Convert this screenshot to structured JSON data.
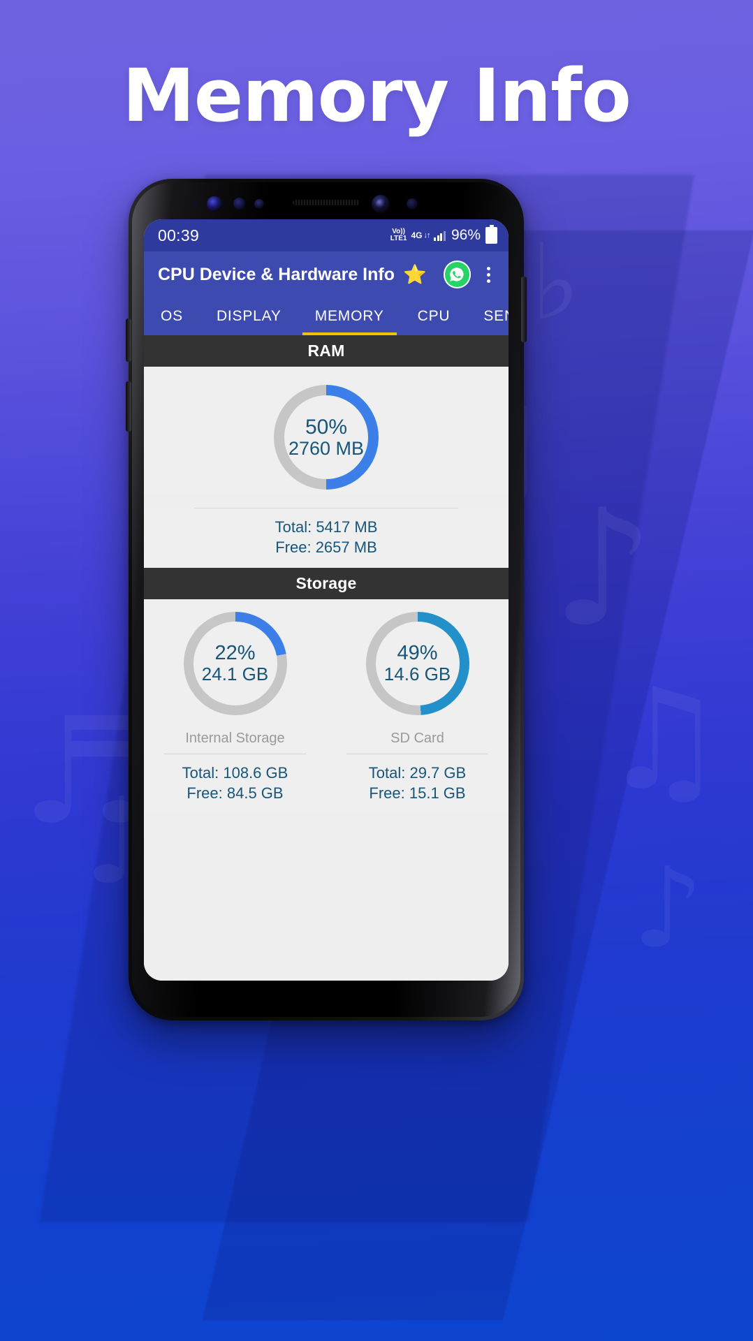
{
  "headline": "Memory Info",
  "status_bar": {
    "time": "00:39",
    "volte_line1": "Vo))",
    "volte_line2": "LTE1",
    "network": "4G",
    "data_arrows": "↓↑",
    "battery_percent": "96%"
  },
  "app_bar": {
    "title": "CPU Device & Hardware Info",
    "star": "⭐",
    "whatsapp_label": "WhatsApp",
    "overflow_label": "More options"
  },
  "tabs": [
    {
      "label": "OS",
      "active": false
    },
    {
      "label": "DISPLAY",
      "active": false
    },
    {
      "label": "MEMORY",
      "active": true
    },
    {
      "label": "CPU",
      "active": false
    },
    {
      "label": "SENSORS",
      "active": false
    }
  ],
  "ram": {
    "section_title": "RAM",
    "percent": "50%",
    "percent_value": 50,
    "used": "2760 MB",
    "total": "Total: 5417 MB",
    "free": "Free: 2657 MB",
    "arc_color": "#3d7fe8",
    "track_color": "#c6c6c6"
  },
  "storage": {
    "section_title": "Storage",
    "items": [
      {
        "label": "Internal Storage",
        "percent": "22%",
        "percent_value": 22,
        "used": "24.1 GB",
        "total": "Total: 108.6 GB",
        "free": "Free: 84.5 GB",
        "arc_color": "#3d7fe8",
        "track_color": "#c6c6c6"
      },
      {
        "label": "SD Card",
        "percent": "49%",
        "percent_value": 49,
        "used": "14.6 GB",
        "total": "Total: 29.7 GB",
        "free": "Free: 15.1 GB",
        "arc_color": "#2390c9",
        "track_color": "#c6c6c6"
      }
    ]
  },
  "colors": {
    "app_bar": "#3d4bb0",
    "status_bar": "#2e3a9e",
    "section_header": "#333333",
    "accent_underline": "#f2c200",
    "text_value": "#185579",
    "content_bg": "#efefef"
  }
}
